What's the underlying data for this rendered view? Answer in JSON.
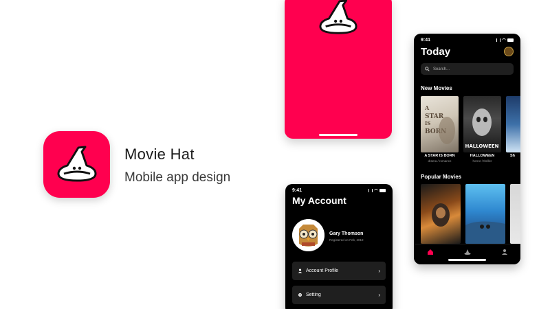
{
  "branding": {
    "app_name": "Movie Hat",
    "subtitle": "Mobile app design",
    "brand_color": "#ff004f"
  },
  "today_screen": {
    "status_time": "9:41",
    "title": "Today",
    "search_placeholder": "Search...",
    "new_movies_label": "New Movies",
    "new_movies": [
      {
        "title": "A STAR IS BORN",
        "genre": "drama / romance",
        "poster_text": "A STAR IS BORN"
      },
      {
        "title": "HALLOWEEN",
        "genre": "horror / thriller",
        "poster_text": "HALLOWEEN"
      },
      {
        "title": "Sh",
        "genre": "",
        "poster_text": ""
      }
    ],
    "popular_movies_label": "Popular Movies",
    "tabs": [
      "home-icon",
      "hat-icon",
      "person-icon"
    ]
  },
  "account_screen": {
    "status_time": "9:41",
    "title": "My Account",
    "user_name": "Gary Thomson",
    "registered": "Registered on Feb, 2019",
    "menu": [
      {
        "label": "Account Profile",
        "icon": "person-icon"
      },
      {
        "label": "Setting",
        "icon": "gear-icon"
      }
    ]
  }
}
